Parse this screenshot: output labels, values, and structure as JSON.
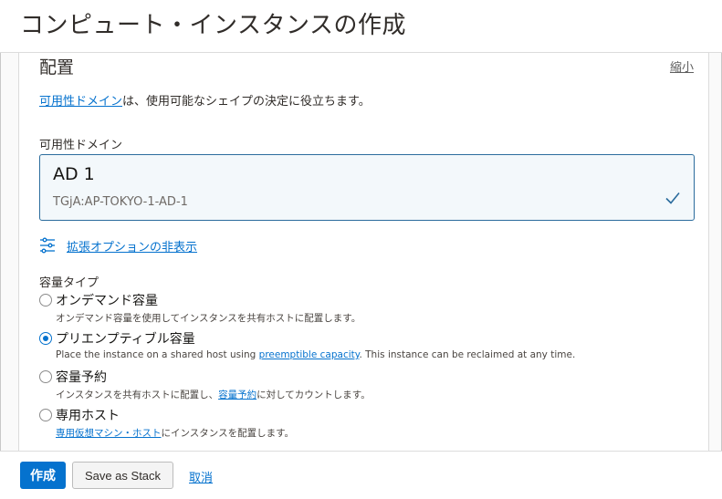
{
  "header": {
    "title": "コンピュート・インスタンスの作成"
  },
  "placement": {
    "title": "配置",
    "collapse_label": "縮小",
    "intro_link": "可用性ドメイン",
    "intro_text": "は、使用可能なシェイプの決定に役立ちます。",
    "field_label": "可用性ドメイン",
    "selected_ad": {
      "name": "AD 1",
      "id": "TGjA:AP-TOKYO-1-AD-1",
      "selected": true
    },
    "advanced_toggle": "拡張オプションの非表示",
    "capacity_label": "容量タイプ",
    "options": [
      {
        "label": "オンデマンド容量",
        "desc_before": "オンデマンド容量を使用してインスタンスを共有ホストに配置します。",
        "desc_link": "",
        "desc_after": "",
        "checked": false
      },
      {
        "label": "プリエンプティブル容量",
        "desc_before": "Place the instance on a shared host using ",
        "desc_link": "preemptible capacity",
        "desc_after": ". This instance can be reclaimed at any time.",
        "checked": true
      },
      {
        "label": "容量予約",
        "desc_before": "インスタンスを共有ホストに配置し、",
        "desc_link": "容量予約",
        "desc_after": "に対してカウントします。",
        "checked": false
      },
      {
        "label": "専用ホスト",
        "desc_before": "",
        "desc_link": "専用仮想マシン・ホスト",
        "desc_after": "にインスタンスを配置します。",
        "checked": false
      }
    ]
  },
  "footer": {
    "create_label": "作成",
    "stack_label": "Save as Stack",
    "cancel_label": "取消"
  },
  "colors": {
    "accent": "#0572ce",
    "selected_border": "#2b6c9d",
    "selected_bg": "#f3f8fb"
  }
}
